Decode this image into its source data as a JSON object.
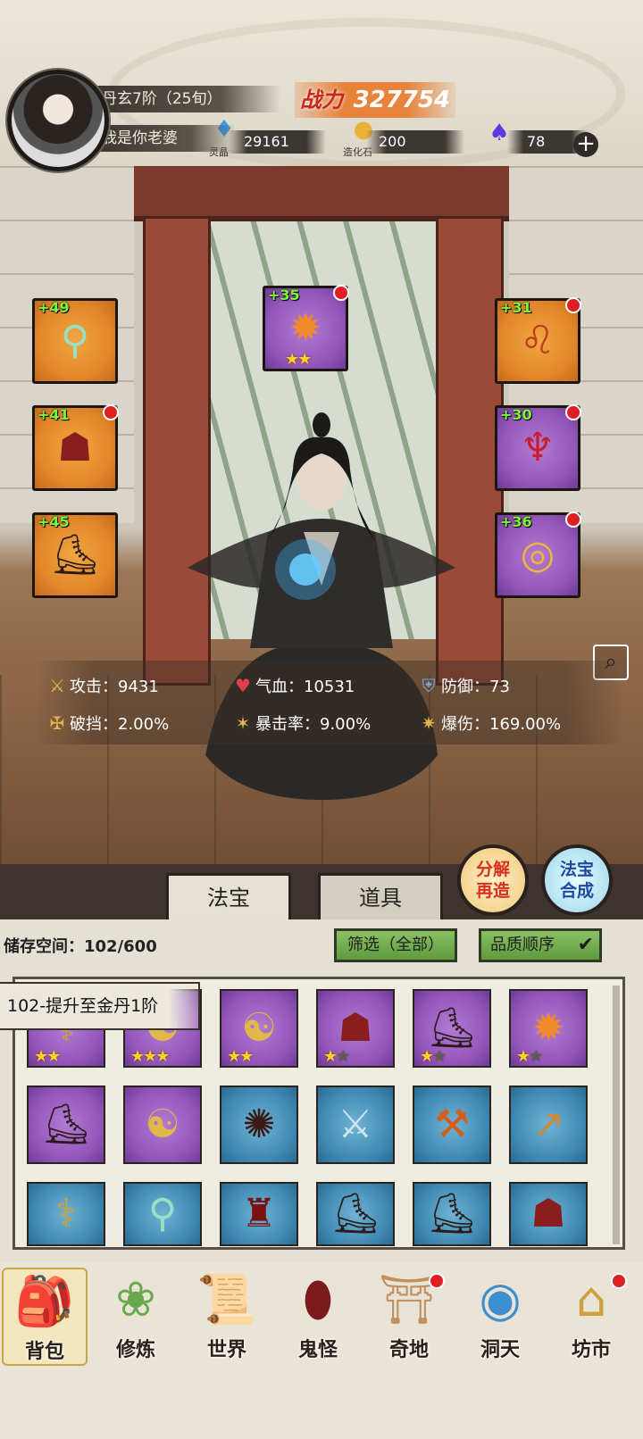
{
  "header": {
    "player_name": "丹玄7阶（25旬）",
    "player_title": "我是你老婆",
    "power_label": "战力",
    "power_value": "327754",
    "resources": [
      {
        "icon": "crystal-icon",
        "caption": "灵晶",
        "value": "29161"
      },
      {
        "icon": "egg-stone-icon",
        "caption": "造化石",
        "value": "200"
      },
      {
        "icon": "flame-icon",
        "caption": "",
        "value": "78"
      }
    ],
    "plus_label": "+"
  },
  "equipment": {
    "left": [
      {
        "level": "+49",
        "rarity": "orange",
        "icon": "mirror-icon",
        "red_dot": false
      },
      {
        "level": "+41",
        "rarity": "orange",
        "icon": "armor-icon",
        "red_dot": true
      },
      {
        "level": "+45",
        "rarity": "orange",
        "icon": "boots-icon",
        "red_dot": false
      }
    ],
    "center": {
      "level": "+35",
      "rarity": "purple",
      "icon": "orb-emblem-icon",
      "red_dot": true,
      "stars": 2
    },
    "right": [
      {
        "level": "+31",
        "rarity": "orange",
        "icon": "lion-icon",
        "red_dot": true
      },
      {
        "level": "+30",
        "rarity": "purple",
        "icon": "amulet-icon",
        "red_dot": true
      },
      {
        "level": "+36",
        "rarity": "purple",
        "icon": "ring-icon",
        "red_dot": true
      }
    ]
  },
  "stats": [
    {
      "icon": "sword-icon",
      "label": "攻击：9431",
      "color": "#e0b64a"
    },
    {
      "icon": "heart-icon",
      "label": "气血：10531",
      "color": "#e0404a"
    },
    {
      "icon": "shield-icon",
      "label": "防御：73",
      "color": "#7aa7e0"
    },
    {
      "icon": "broken-shield-icon",
      "label": "破挡：2.00%",
      "color": "#e0b64a"
    },
    {
      "icon": "crit-icon",
      "label": "暴击率：9.00%",
      "color": "#e0b64a"
    },
    {
      "icon": "crit-damage-icon",
      "label": "爆伤：169.00%",
      "color": "#e0b64a"
    }
  ],
  "tabs": [
    {
      "label": "法宝",
      "active": true
    },
    {
      "label": "道具",
      "active": false
    }
  ],
  "round_buttons": [
    {
      "label_top": "分解",
      "label_bottom": "再造"
    },
    {
      "label_top": "法宝",
      "label_bottom": "合成"
    }
  ],
  "storage": {
    "label": "储存空间：102/600",
    "filter_label": "筛选（全部）",
    "sort_label": "品质顺序",
    "tip": "102-提升至金丹1阶"
  },
  "inventory": [
    {
      "rarity": "purple",
      "icon": "staff-icon",
      "stars": 2,
      "max": 2
    },
    {
      "rarity": "purple",
      "icon": "dragon-icon",
      "stars": 3,
      "max": 3
    },
    {
      "rarity": "purple",
      "icon": "dragon-icon",
      "stars": 2,
      "max": 2
    },
    {
      "rarity": "purple",
      "icon": "armor-icon",
      "stars": 1,
      "max": 2
    },
    {
      "rarity": "purple",
      "icon": "boots-icon",
      "stars": 1,
      "max": 2
    },
    {
      "rarity": "purple",
      "icon": "orb-emblem-icon",
      "stars": 1,
      "max": 2
    },
    {
      "rarity": "purple",
      "icon": "boots-icon",
      "stars": 0,
      "max": 0
    },
    {
      "rarity": "purple",
      "icon": "dragon-icon",
      "stars": 0,
      "max": 0
    },
    {
      "rarity": "blue",
      "icon": "wheel-icon",
      "stars": 0,
      "max": 0
    },
    {
      "rarity": "blue",
      "icon": "sword-icon",
      "stars": 0,
      "max": 0
    },
    {
      "rarity": "blue",
      "icon": "axe-icon",
      "stars": 0,
      "max": 0
    },
    {
      "rarity": "blue",
      "icon": "spear-icon",
      "stars": 0,
      "max": 0
    },
    {
      "rarity": "blue",
      "icon": "staff-icon",
      "stars": 0,
      "max": 0
    },
    {
      "rarity": "blue",
      "icon": "mirror-icon",
      "stars": 0,
      "max": 0
    },
    {
      "rarity": "blue",
      "icon": "robe-icon",
      "stars": 0,
      "max": 0
    },
    {
      "rarity": "blue",
      "icon": "boots-icon",
      "stars": 0,
      "max": 0
    },
    {
      "rarity": "blue",
      "icon": "boots-icon",
      "stars": 0,
      "max": 0
    },
    {
      "rarity": "blue",
      "icon": "armor-icon",
      "stars": 0,
      "max": 0
    }
  ],
  "nav": [
    {
      "label": "背包",
      "icon": "bag-icon",
      "active": true,
      "dot": false
    },
    {
      "label": "修炼",
      "icon": "lotus-icon",
      "active": false,
      "dot": false
    },
    {
      "label": "世界",
      "icon": "scroll-map-icon",
      "active": false,
      "dot": false
    },
    {
      "label": "鬼怪",
      "icon": "demon-egg-icon",
      "active": false,
      "dot": false
    },
    {
      "label": "奇地",
      "icon": "pavilion-icon",
      "active": false,
      "dot": true
    },
    {
      "label": "洞天",
      "icon": "portal-icon",
      "active": false,
      "dot": false
    },
    {
      "label": "坊市",
      "icon": "market-icon",
      "active": false,
      "dot": true
    }
  ]
}
